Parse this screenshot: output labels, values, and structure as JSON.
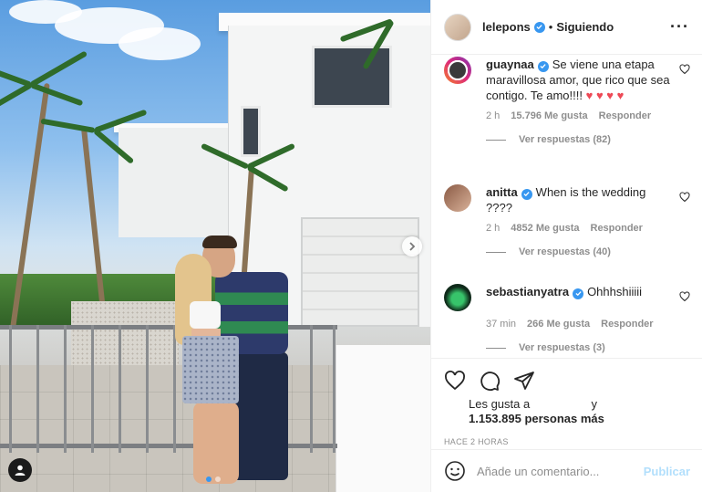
{
  "post": {
    "author": "lelepons",
    "follow_sep": "•",
    "follow_status": "Siguiendo",
    "more_icon": "···",
    "image_index": 1,
    "image_count": 2
  },
  "comments": [
    {
      "user": "guaynaa",
      "verified": true,
      "text": "Se viene una etapa maravillosa amor, que rico que sea contigo. Te amo!!!!",
      "emoji": "♥ ♥ ♥ ♥",
      "time": "2 h",
      "likes": "15.796 Me gusta",
      "reply": "Responder",
      "replies": "Ver respuestas (82)"
    },
    {
      "user": "anitta",
      "verified": true,
      "text": "When is the wedding ????",
      "time": "2 h",
      "likes": "4852 Me gusta",
      "reply": "Responder",
      "replies": "Ver respuestas (40)"
    },
    {
      "user": "sebastianyatra",
      "verified": true,
      "text": "Ohhhshiiiii",
      "time": "37 min",
      "likes": "266 Me gusta",
      "reply": "Responder",
      "replies": "Ver respuestas (3)"
    }
  ],
  "likes": {
    "prefix": "Les gusta a",
    "and": "y",
    "count": "1.153.895 personas más"
  },
  "timestamp": "HACE 2 HORAS",
  "composer": {
    "placeholder": "Añade un comentario...",
    "publish": "Publicar"
  },
  "colors": {
    "verified": "#3897f0",
    "heart": "#ed4956",
    "publish": "#b2dffc",
    "muted": "#8e8e8e"
  }
}
